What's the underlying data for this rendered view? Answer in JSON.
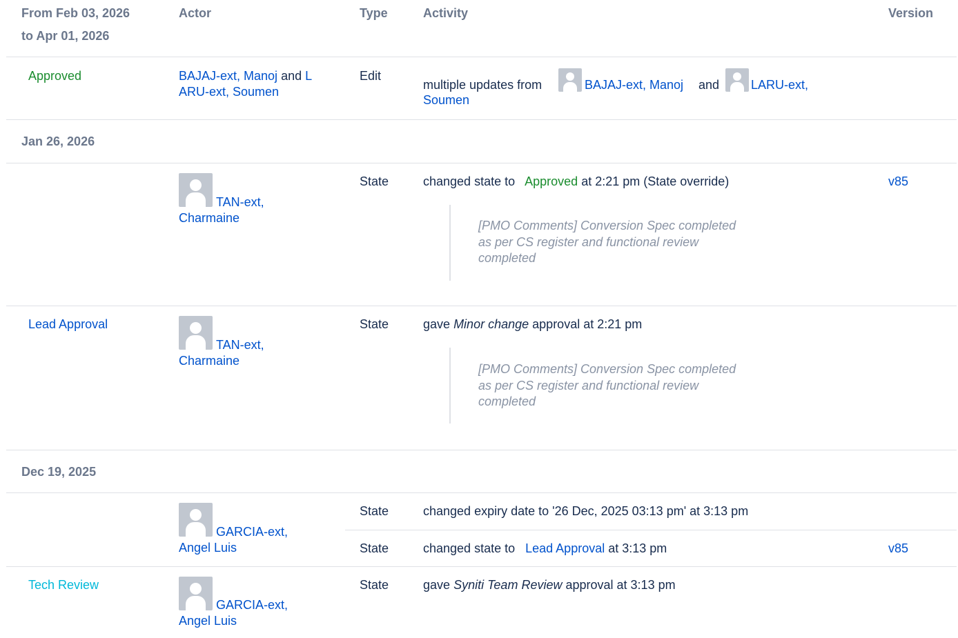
{
  "header": {
    "range_line1": "From Feb 03, 2026",
    "range_line2": "to Apr 01, 2026",
    "actor": "Actor",
    "type": "Type",
    "activity": "Activity",
    "version": "Version"
  },
  "row1": {
    "state": "Approved",
    "actor_a": "BAJAJ-ext, Manoj",
    "and": "and",
    "actor_b_l1": "L",
    "actor_b_l2": "ARU-ext, Soumen",
    "type": "Edit",
    "activity_prefix": "multiple updates from",
    "activity_actor_a": "BAJAJ-ext, Manoj",
    "activity_and": "and",
    "activity_actor_b_l1": "LARU-ext,",
    "activity_actor_b_l2": "Soumen"
  },
  "group1": {
    "date": "Jan 26, 2026"
  },
  "row2": {
    "actor_l1": "TAN-ext,",
    "actor_l2": "Charmaine",
    "type": "State",
    "activity_prefix": "changed state to",
    "activity_state": "Approved",
    "activity_suffix": "at 2:21 pm (State override)",
    "version": "v85",
    "comment_l1": "[PMO Comments] Conversion Spec completed",
    "comment_l2": "as per CS register and functional review",
    "comment_l3": "completed"
  },
  "row3": {
    "state": "Lead Approval",
    "actor_l1": "TAN-ext,",
    "actor_l2": "Charmaine",
    "type": "State",
    "activity_prefix": "gave",
    "activity_em": "Minor change",
    "activity_suffix": "approval at 2:21 pm",
    "comment_l1": "[PMO Comments] Conversion Spec completed",
    "comment_l2": "as per CS register and functional review",
    "comment_l3": "completed"
  },
  "group2": {
    "date": "Dec 19, 2025"
  },
  "row4": {
    "actor_l1": "GARCIA-ext,",
    "actor_l2": "Angel Luis",
    "type_a": "State",
    "activity_a": "changed expiry date to '26 Dec, 2025 03:13 pm' at 3:13 pm",
    "type_b": "State",
    "activity_b_prefix": "changed state to",
    "activity_b_state": "Lead Approval",
    "activity_b_suffix": "at 3:13 pm",
    "version_b": "v85"
  },
  "row5": {
    "state": "Tech Review",
    "actor_l1": "GARCIA-ext,",
    "actor_l2": "Angel Luis",
    "type": "State",
    "activity_prefix": "gave",
    "activity_em": "Syniti Team Review",
    "activity_suffix": "approval at 3:13 pm"
  },
  "colors": {
    "link": "#0052cc",
    "approved": "#1a8c2e",
    "tech_review": "#00b8d9",
    "header_text": "#6b778c",
    "divider": "#dfe1e6",
    "comment_text": "#8993a4"
  }
}
